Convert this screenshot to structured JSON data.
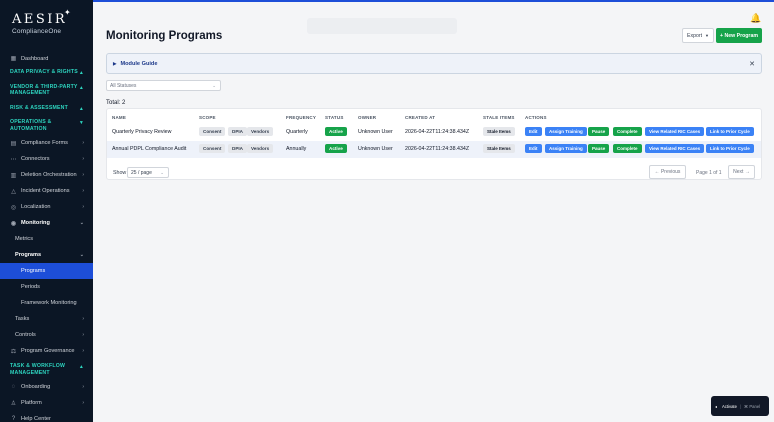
{
  "brand": {
    "name": "AESIR",
    "subtitle": "ComplianceOne"
  },
  "sidebar": {
    "dashboard": "Dashboard",
    "sections": {
      "data_privacy": "DATA PRIVACY & RIGHTS",
      "vendor": "VENDOR & THIRD-PARTY MANAGEMENT",
      "risk": "RISK & ASSESSMENT",
      "ops": "OPERATIONS & AUTOMATION",
      "task": "TASK & WORKFLOW MANAGEMENT"
    },
    "items": {
      "compliance_forms": "Compliance Forms",
      "connectors": "Connectors",
      "deletion": "Deletion Orchestration",
      "incident": "Incident Operations",
      "localization": "Localization",
      "monitoring": "Monitoring",
      "metrics": "Metrics",
      "programs": "Programs",
      "programs_sub": "Programs",
      "periods": "Periods",
      "framework": "Framework Monitoring",
      "tasks": "Tasks",
      "controls": "Controls",
      "program_governance": "Program Governance",
      "onboarding": "Onboarding",
      "platform": "Platform",
      "help": "Help Center"
    }
  },
  "header": {
    "title": "Monitoring Programs",
    "export_label": "Export",
    "new_label": "+ New Program"
  },
  "guide": {
    "label": "Module Guide"
  },
  "filters": {
    "status_value": "All Statuses"
  },
  "table": {
    "total": "Total: 2",
    "columns": [
      "NAME",
      "SCOPE",
      "FREQUENCY",
      "STATUS",
      "OWNER",
      "CREATED AT",
      "STALE ITEMS",
      "ACTIONS"
    ],
    "rows": [
      {
        "name": "Quarterly Privacy Review",
        "scope": [
          "Consent",
          "DPIA",
          "Vendors"
        ],
        "frequency": "Quarterly",
        "status": "Active",
        "owner": "Unknown User",
        "created_at": "2026-04-22T11:24:38.434Z",
        "stale": "Stale Items"
      },
      {
        "name": "Annual PDPL Compliance Audit",
        "scope": [
          "Consent",
          "DPIA",
          "Vendors"
        ],
        "frequency": "Annually",
        "status": "Active",
        "owner": "Unknown User",
        "created_at": "2026-04-22T11:24:38.434Z",
        "stale": "Stale Items"
      }
    ],
    "actions": {
      "edit": "Edit",
      "assign": "Assign Training",
      "pause": "Pause",
      "complete": "Complete",
      "view_ric": "View Related RIC Cases",
      "link_prior": "Link to Prior Cycle"
    }
  },
  "pagination": {
    "show_label": "Show",
    "per_page": "25 / page",
    "prev": "← Previous",
    "page_info": "Page 1 of 1",
    "next": "Next →"
  },
  "float_panel": {
    "activate": "Activate",
    "panel": "⌘ Panel"
  },
  "colors": {
    "accent": "#1d4ed8",
    "success": "#16a34a",
    "section": "#2dd4bf",
    "sidebar": "#0b1625"
  }
}
